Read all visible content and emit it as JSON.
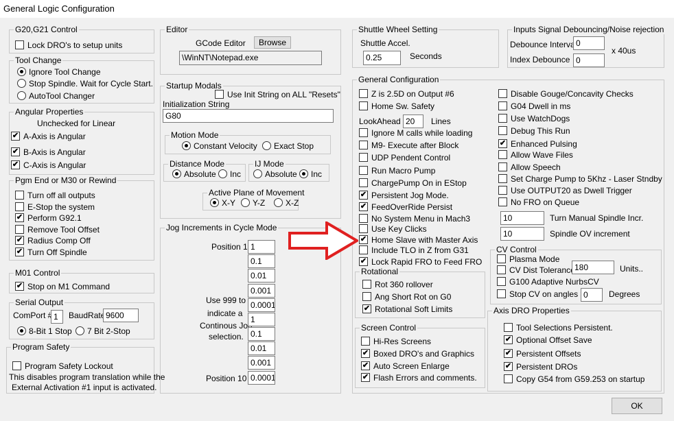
{
  "window": {
    "title": "General Logic Configuration"
  },
  "g20": {
    "title": "G20,G21 Control",
    "lock": {
      "label": "Lock DRO's to setup units",
      "checked": false
    }
  },
  "tool_change": {
    "title": "Tool Change",
    "options": [
      {
        "label": "Ignore Tool Change",
        "selected": true
      },
      {
        "label": "Stop Spindle. Wait for Cycle Start.",
        "selected": false
      },
      {
        "label": "AutoTool Changer",
        "selected": false
      }
    ]
  },
  "angular": {
    "title": "Angular Properties",
    "note": "Unchecked for Linear",
    "items": [
      {
        "label": "A-Axis is Angular",
        "checked": true
      },
      {
        "label": "B-Axis is Angular",
        "checked": true
      },
      {
        "label": "C-Axis is Angular",
        "checked": true
      }
    ]
  },
  "pgm_end": {
    "title": "Pgm End or M30 or Rewind",
    "items": [
      {
        "label": "Turn off all outputs",
        "checked": false
      },
      {
        "label": "E-Stop the system",
        "checked": false
      },
      {
        "label": "Perform G92.1",
        "checked": true
      },
      {
        "label": "Remove Tool Offset",
        "checked": false
      },
      {
        "label": "Radius Comp Off",
        "checked": true
      },
      {
        "label": "Turn Off Spindle",
        "checked": true
      }
    ]
  },
  "m01": {
    "title": "M01 Control",
    "stop": {
      "label": "Stop on M1 Command",
      "checked": true
    }
  },
  "serial": {
    "title": "Serial Output",
    "comport_label": "ComPort #",
    "comport": "1",
    "baud_label": "BaudRate",
    "baud": "9600",
    "bits": [
      {
        "label": "8-Bit 1 Stop",
        "selected": true
      },
      {
        "label": "7 Bit 2-Stop",
        "selected": false
      }
    ]
  },
  "safety": {
    "title": "Program Safety",
    "lockout": {
      "label": "Program Safety Lockout",
      "checked": false
    },
    "note1": "This disables program translation while the",
    "note2": "External Activation #1 input is activated."
  },
  "editor": {
    "title": "Editor",
    "label": "GCode Editor",
    "browse": "Browse",
    "path": "\\WinNT\\Notepad.exe"
  },
  "startup": {
    "title": "Startup Modals",
    "use_init": {
      "label": "Use Init String on ALL  \"Resets\"",
      "checked": false
    },
    "init_label": "Initialization String",
    "init_value": "G80",
    "motion": {
      "title": "Motion Mode",
      "options": [
        {
          "label": "Constant Velocity",
          "selected": true
        },
        {
          "label": "Exact Stop",
          "selected": false
        }
      ]
    },
    "distance": {
      "title": "Distance Mode",
      "options": [
        {
          "label": "Absolute",
          "selected": true
        },
        {
          "label": "Inc",
          "selected": false
        }
      ]
    },
    "ij": {
      "title": "IJ Mode",
      "options": [
        {
          "label": "Absolute",
          "selected": false
        },
        {
          "label": "Inc",
          "selected": true
        }
      ]
    },
    "plane": {
      "title": "Active Plane of Movement",
      "options": [
        {
          "label": "X-Y",
          "selected": true
        },
        {
          "label": "Y-Z",
          "selected": false
        },
        {
          "label": "X-Z",
          "selected": false
        }
      ]
    }
  },
  "jog": {
    "title": "Jog Increments in Cycle Mode",
    "pos1": "Position 1",
    "pos10": "Position 10",
    "note": [
      "Use 999 to",
      "indicate a",
      "Continous Jog",
      "selection."
    ],
    "values": [
      "1",
      "0.1",
      "0.01",
      "0.001",
      "0.0001",
      "1",
      "0.1",
      "0.01",
      "0.001",
      "0.0001"
    ]
  },
  "shuttle": {
    "title": "Shuttle Wheel Setting",
    "label": "Shuttle Accel.",
    "value": "0.25",
    "unit": "Seconds"
  },
  "debounce": {
    "title": "Inputs Signal Debouncing/Noise rejection",
    "interval_label": "Debounce Interval",
    "interval": "0",
    "index_label": "Index Debounce",
    "index": "0",
    "unit": "x 40us"
  },
  "general": {
    "title": "General Configuration",
    "left": [
      {
        "label": "Z is 2.5D on Output #6",
        "checked": false
      },
      {
        "label": "Home Sw. Safety",
        "checked": false
      },
      {
        "label": "Ignore M calls while loading",
        "checked": false
      },
      {
        "label": "M9- Execute after Block",
        "checked": false
      },
      {
        "label": "UDP Pendent Control",
        "checked": false
      },
      {
        "label": "Run Macro Pump",
        "checked": false
      },
      {
        "label": "ChargePump On in EStop",
        "checked": false
      },
      {
        "label": "Persistent Jog Mode.",
        "checked": true
      },
      {
        "label": "FeedOverRide Persist",
        "checked": true
      },
      {
        "label": "No System Menu in Mach3",
        "checked": false
      },
      {
        "label": "Use Key Clicks",
        "checked": false
      },
      {
        "label": "Home Slave with Master Axis",
        "checked": true
      },
      {
        "label": "Include TLO in Z from G31",
        "checked": false
      },
      {
        "label": "Lock Rapid FRO to Feed FRO",
        "checked": true
      }
    ],
    "lookahead_label": "LookAhead",
    "lookahead": "20",
    "lookahead_unit": "Lines",
    "right": [
      {
        "label": "Disable Gouge/Concavity Checks",
        "checked": false
      },
      {
        "label": "G04 Dwell in ms",
        "checked": false
      },
      {
        "label": "Use WatchDogs",
        "checked": false
      },
      {
        "label": "Debug This Run",
        "checked": false
      },
      {
        "label": "Enhanced Pulsing",
        "checked": true
      },
      {
        "label": "Allow Wave Files",
        "checked": false
      },
      {
        "label": "Allow Speech",
        "checked": false
      },
      {
        "label": "Set Charge Pump to 5Khz  - Laser Stndby",
        "checked": false
      },
      {
        "label": "Use OUTPUT20 as Dwell Trigger",
        "checked": false
      },
      {
        "label": "No FRO on Queue",
        "checked": false
      }
    ],
    "manual_incr": "10",
    "manual_incr_label": "Turn Manual Spindle Incr.",
    "spindle_ov": "10",
    "spindle_ov_label": "Spindle OV increment"
  },
  "rotational": {
    "title": "Rotational",
    "items": [
      {
        "label": "Rot 360 rollover",
        "checked": false
      },
      {
        "label": "Ang Short Rot on G0",
        "checked": false
      },
      {
        "label": "Rotational Soft Limits",
        "checked": true
      }
    ]
  },
  "screen": {
    "title": "Screen Control",
    "items": [
      {
        "label": "Hi-Res Screens",
        "checked": false
      },
      {
        "label": "Boxed DRO's and Graphics",
        "checked": true
      },
      {
        "label": "Auto Screen Enlarge",
        "checked": true
      },
      {
        "label": "Flash Errors and comments.",
        "checked": true
      }
    ]
  },
  "cv": {
    "title": "CV Control",
    "plasma": {
      "label": "Plasma Mode",
      "checked": false
    },
    "cvdist": {
      "label": "CV Dist Tolerance",
      "checked": false
    },
    "cvdist_value": "180",
    "cvdist_unit": "Units..",
    "g100": {
      "label": "G100 Adaptive NurbsCV",
      "checked": false
    },
    "stopcv": {
      "label": "Stop CV on angles >",
      "checked": false
    },
    "stopcv_value": "0",
    "stopcv_unit": "Degrees"
  },
  "axis_dro": {
    "title": "Axis DRO Properties",
    "items": [
      {
        "label": "Tool Selections Persistent.",
        "checked": false
      },
      {
        "label": "Optional Offset Save",
        "checked": true
      },
      {
        "label": "Persistent Offsets",
        "checked": true
      },
      {
        "label": "Persistent DROs",
        "checked": true
      },
      {
        "label": "Copy G54 from G59.253 on startup",
        "checked": false
      }
    ]
  },
  "ok": "OK",
  "colors": {
    "arrow": "#e02020",
    "bg": "#f0f0f0"
  }
}
